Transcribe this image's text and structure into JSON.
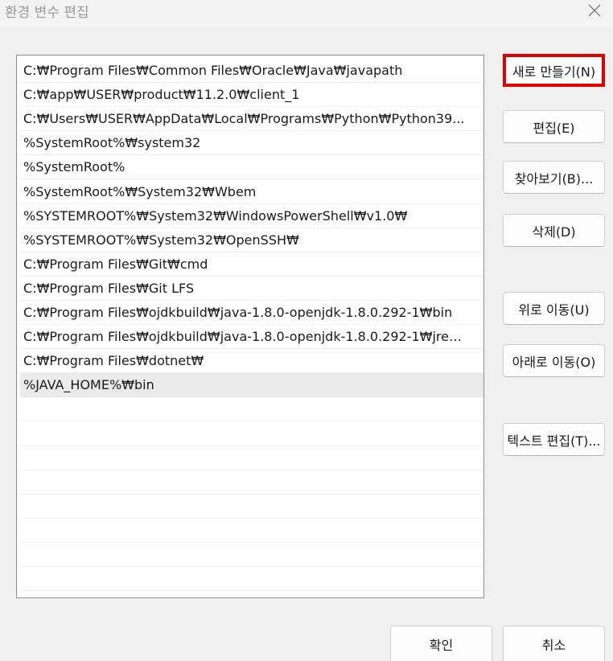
{
  "window": {
    "title": "환경 변수 편집",
    "close_icon": "close-icon"
  },
  "path_list": {
    "items": [
      "C:₩Program Files₩Common Files₩Oracle₩Java₩javapath",
      "C:₩app₩USER₩product₩11.2.0₩client_1",
      "C:₩Users₩USER₩AppData₩Local₩Programs₩Python₩Python39...",
      "%SystemRoot%₩system32",
      "%SystemRoot%",
      "%SystemRoot%₩System32₩Wbem",
      "%SYSTEMROOT%₩System32₩WindowsPowerShell₩v1.0₩",
      "%SYSTEMROOT%₩System32₩OpenSSH₩",
      "C:₩Program Files₩Git₩cmd",
      "C:₩Program Files₩Git LFS",
      "C:₩Program Files₩ojdkbuild₩java-1.8.0-openjdk-1.8.0.292-1₩bin",
      "C:₩Program Files₩ojdkbuild₩java-1.8.0-openjdk-1.8.0.292-1₩jre₩...",
      "C:₩Program Files₩dotnet₩",
      "%JAVA_HOME%₩bin"
    ],
    "selected_index": 13,
    "empty_rows": 8
  },
  "buttons": {
    "new": "새로 만들기(N)",
    "edit": "편집(E)",
    "browse": "찾아보기(B)...",
    "delete": "삭제(D)",
    "move_up": "위로 이동(U)",
    "move_down": "아래로 이동(O)",
    "edit_text": "텍스트 편집(T)...",
    "ok": "확인",
    "cancel": "취소"
  },
  "colors": {
    "highlight_border": "#e00000",
    "selected_row": "#ebebeb"
  }
}
